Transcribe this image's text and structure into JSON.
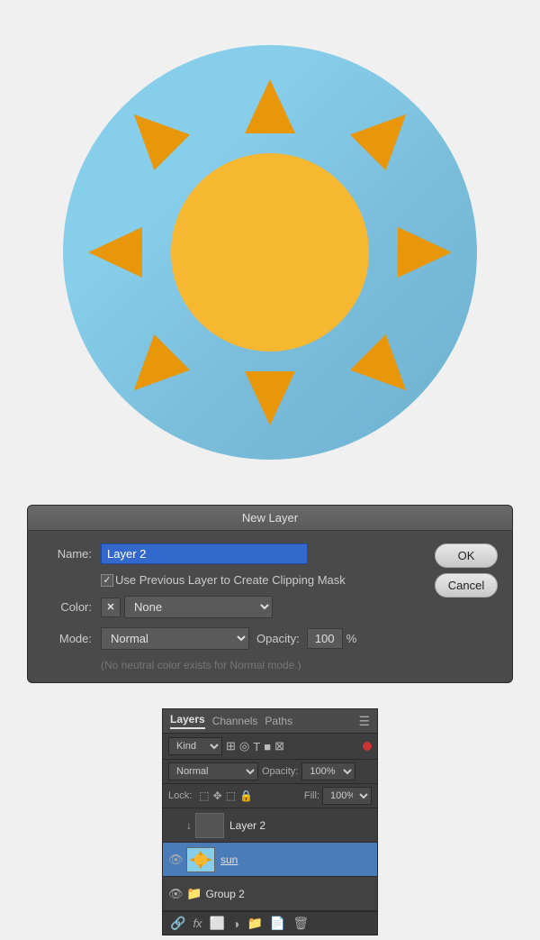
{
  "illustration": {
    "alt": "Sun flat icon on light blue circle"
  },
  "dialog": {
    "title": "New Layer",
    "name_label": "Name:",
    "name_value": "Layer 2",
    "checkbox_label": "Use Previous Layer to Create Clipping Mask",
    "color_label": "Color:",
    "color_value": "None",
    "mode_label": "Mode:",
    "mode_value": "Normal",
    "opacity_label": "Opacity:",
    "opacity_value": "100",
    "opacity_pct": "%",
    "neutral_text": "(No neutral color exists for Normal mode.)",
    "ok_label": "OK",
    "cancel_label": "Cancel"
  },
  "layers_panel": {
    "title": "Layers",
    "tab_channels": "Channels",
    "tab_paths": "Paths",
    "kind_label": "Kind",
    "mode_value": "Normal",
    "opacity_label": "Opacity:",
    "opacity_value": "100%",
    "lock_label": "Lock:",
    "fill_label": "Fill:",
    "fill_value": "100%",
    "layers": [
      {
        "name": "Layer 2",
        "visible": false,
        "type": "empty"
      },
      {
        "name": "sun",
        "visible": true,
        "type": "sun",
        "active": true
      },
      {
        "name": "Group 2",
        "visible": true,
        "type": "group",
        "active": false
      }
    ],
    "toolbar_icons": [
      "link-icon",
      "fx-icon",
      "mask-icon",
      "adjustment-icon",
      "group-icon",
      "new-layer-icon",
      "trash-icon"
    ]
  }
}
